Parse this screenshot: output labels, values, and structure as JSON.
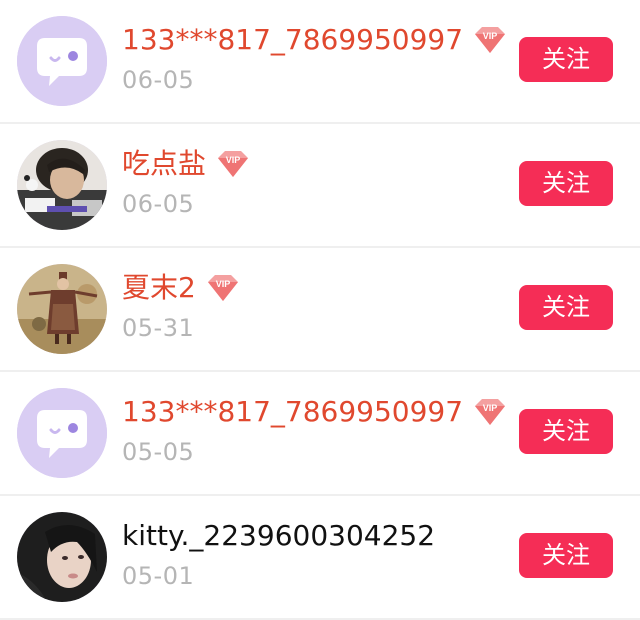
{
  "followers": [
    {
      "name": "133***817_7869950997",
      "vip": true,
      "date": "06-05",
      "avatar": "default-chat-avatar-icon",
      "button": "关注"
    },
    {
      "name": "吃点盐",
      "vip": true,
      "date": "06-05",
      "avatar": "user-photo-avatar",
      "button": "关注"
    },
    {
      "name": "夏末2",
      "vip": true,
      "date": "05-31",
      "avatar": "painting-avatar",
      "button": "关注"
    },
    {
      "name": "133***817_7869950997",
      "vip": true,
      "date": "05-05",
      "avatar": "default-chat-avatar-icon",
      "button": "关注"
    },
    {
      "name": "kitty._2239600304252",
      "vip": false,
      "date": "05-01",
      "avatar": "user-photo-avatar",
      "button": "关注"
    }
  ],
  "badge": {
    "vip_label": "VIP",
    "vip_color": "#f06a6a"
  },
  "colors": {
    "vip_name": "#e0482e",
    "normal_name": "#111111",
    "date": "#b5b5b5",
    "button_bg": "#f52d56",
    "default_avatar_bg": "#d9cdf3"
  }
}
